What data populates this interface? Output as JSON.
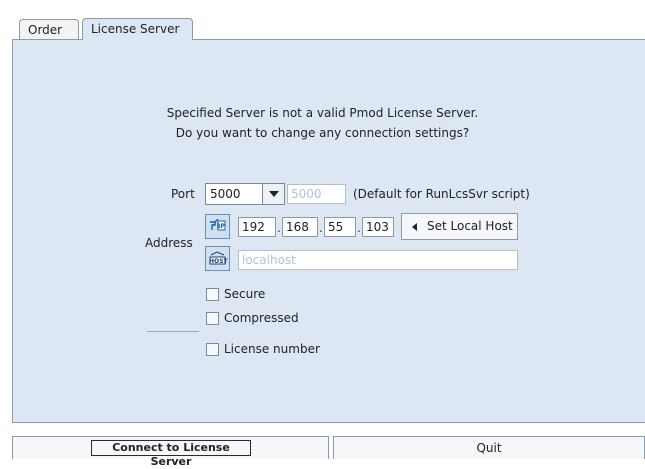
{
  "tabs": [
    {
      "label": "Order",
      "active": false
    },
    {
      "label": "License Server",
      "active": true
    }
  ],
  "message": {
    "line1": "Specified Server is not a valid Pmod License Server.",
    "line2": "Do you want to change any connection settings?"
  },
  "port": {
    "label": "Port",
    "selected": "5000",
    "default_field": "5000",
    "hint": "(Default for RunLcsSvr script)"
  },
  "address": {
    "label": "Address",
    "ip": [
      "192",
      "168",
      "55",
      "103"
    ],
    "ip_icon": "ip-icon",
    "host_icon": "host-icon",
    "host_icon_text": "HOST",
    "hostname": "localhost",
    "set_local_host_label": "Set Local Host"
  },
  "options": {
    "secure": "Secure",
    "compressed": "Compressed",
    "license_number": "License number"
  },
  "footer": {
    "connect_label": "Connect to License Server",
    "quit_label": "Quit"
  },
  "colors": {
    "panel_bg": "#dce7f3",
    "tab_border": "#8a9bb0",
    "disabled_text": "#b4c2d1"
  }
}
